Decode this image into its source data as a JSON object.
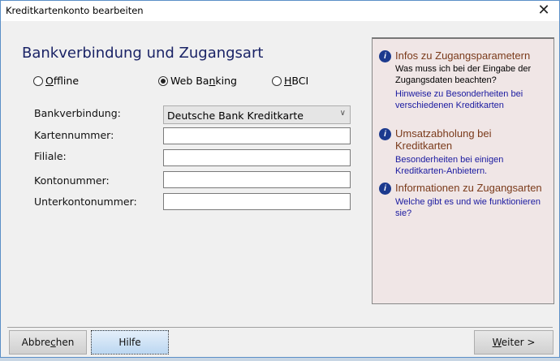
{
  "window": {
    "title": "Kreditkartenkonto bearbeiten",
    "close": "✕"
  },
  "heading": "Bankverbindung und Zugangsart",
  "access_modes": [
    {
      "label": "Offline",
      "accel": "O",
      "rest": "ffline",
      "selected": false
    },
    {
      "label": "Web Banking",
      "pre": "Web Ba",
      "accel": "n",
      "rest": "king",
      "selected": true
    },
    {
      "label": "HBCI",
      "accel": "H",
      "rest": "BCI",
      "selected": false
    }
  ],
  "form": {
    "bankverbindung_label": "Bankverbindung:",
    "bankverbindung_value": "Deutsche Bank Kreditkarte",
    "kartennummer_label": "Kartennummer:",
    "kartennummer_value": "",
    "filiale_label": "Filiale:",
    "filiale_value": "",
    "kontonummer_label": "Kontonummer:",
    "kontonummer_value": "",
    "unterkonto_label": "Unterkontonummer:",
    "unterkonto_value": ""
  },
  "info_panel": [
    {
      "title": "Infos zu Zugangsparametern",
      "desc": "Was muss ich bei der Eingabe der Zugangsdaten beachten?",
      "link": "Hinweise zu Besonderheiten bei verschiedenen Kreditkarten"
    },
    {
      "title": "Umsatzabholung bei Kreditkarten",
      "link": "Besonderheiten bei einigen Kreditkarten-Anbietern."
    },
    {
      "title": "Informationen zu Zugangsarten",
      "link": "Welche gibt es und wie funktionieren sie?"
    }
  ],
  "buttons": {
    "cancel_pre": "Abbre",
    "cancel_accel": "c",
    "cancel_rest": "hen",
    "help": "Hilfe",
    "next_accel": "W",
    "next_rest": "eiter >"
  }
}
